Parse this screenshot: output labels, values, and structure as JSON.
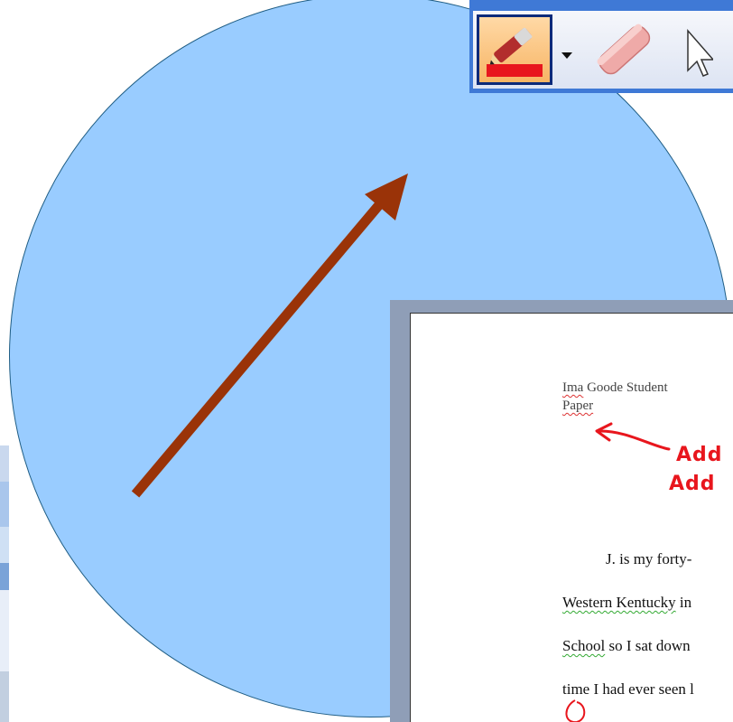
{
  "document": {
    "header_line1": "Ima Goode Student",
    "header_line2": "Paper",
    "annotations": [
      "Add",
      "Add"
    ],
    "body_lines": [
      "J. is my forty-",
      "Western  Kentucky in",
      "School so I sat down",
      "time I had ever seen l"
    ]
  },
  "toolbar": {
    "tools": [
      {
        "name": "pen",
        "icon": "pen-icon",
        "active": true,
        "ink_color": "#e8161d"
      },
      {
        "name": "pen-options",
        "icon": "dropdown-arrow-icon"
      },
      {
        "name": "eraser",
        "icon": "eraser-icon"
      },
      {
        "name": "pointer",
        "icon": "arrow-pointer-icon"
      }
    ]
  },
  "colors": {
    "circle": "#99ccff",
    "arrow": "#9a3308",
    "ink": "#e8161d",
    "toolbar_frame": "#3f79d6"
  }
}
